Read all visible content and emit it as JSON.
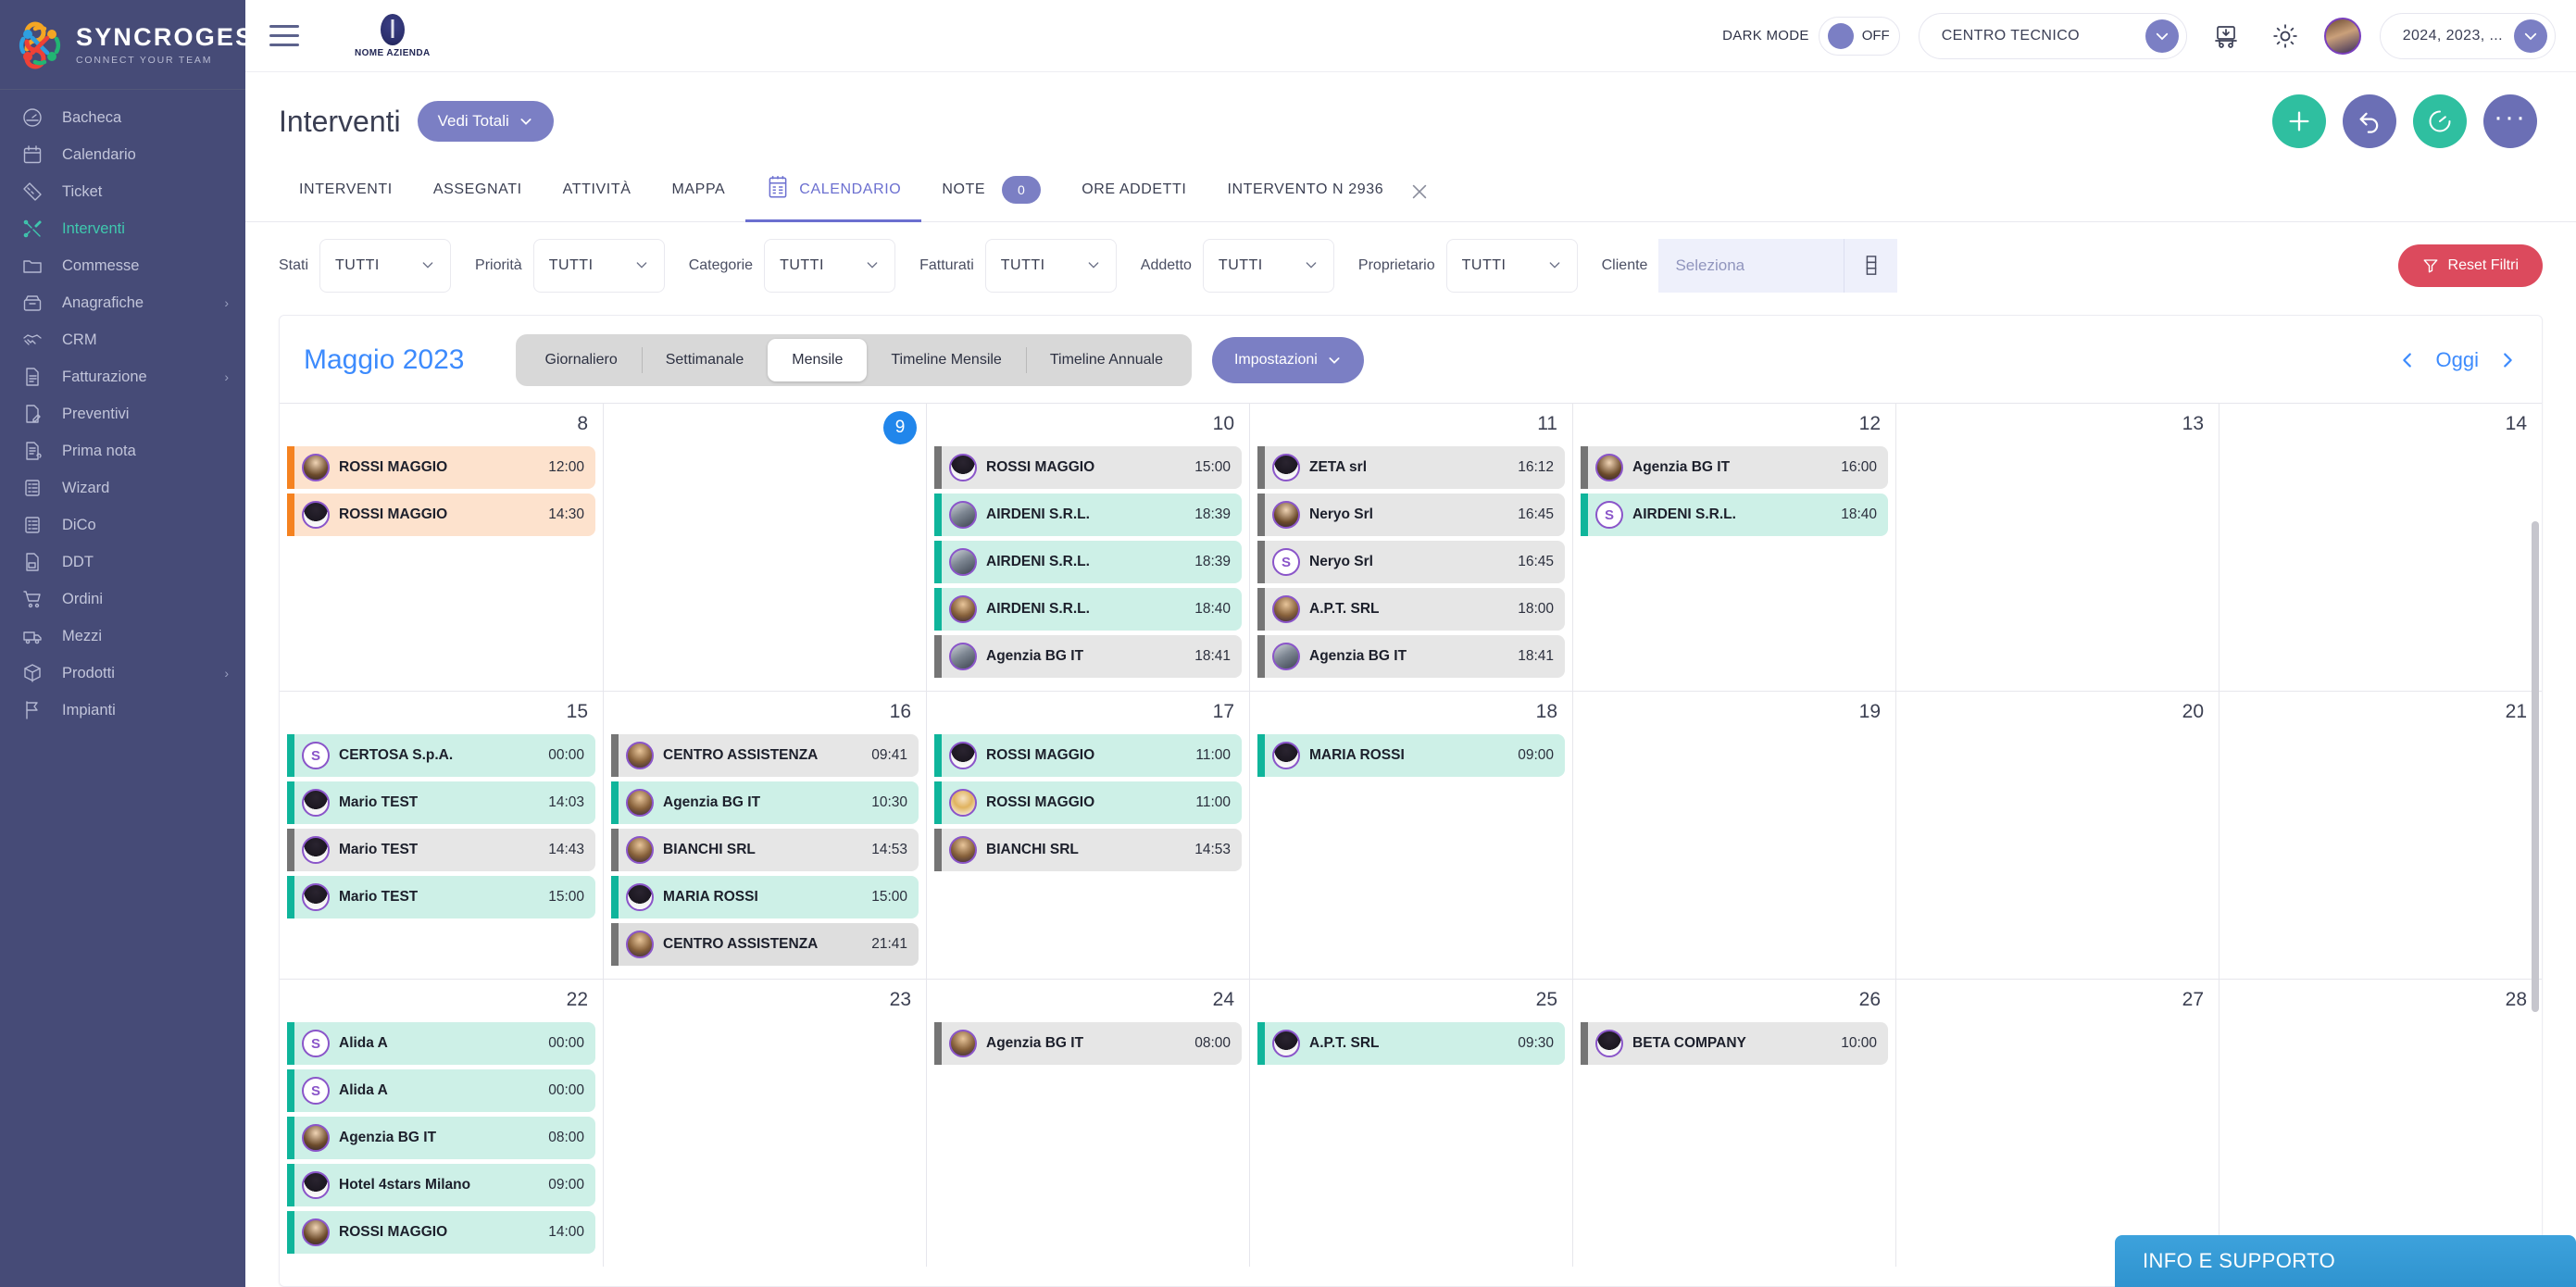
{
  "brand": {
    "name": "SYNCROGEST",
    "tagline": "CONNECT YOUR TEAM"
  },
  "sidebar": {
    "items": [
      {
        "label": "Bacheca",
        "icon": "gauge-icon",
        "active": false,
        "expandable": false
      },
      {
        "label": "Calendario",
        "icon": "calendar-icon",
        "active": false,
        "expandable": false
      },
      {
        "label": "Ticket",
        "icon": "ticket-icon",
        "active": false,
        "expandable": false
      },
      {
        "label": "Interventi",
        "icon": "tools-icon",
        "active": true,
        "expandable": false
      },
      {
        "label": "Commesse",
        "icon": "folder-icon",
        "active": false,
        "expandable": false
      },
      {
        "label": "Anagrafiche",
        "icon": "archive-icon",
        "active": false,
        "expandable": true
      },
      {
        "label": "CRM",
        "icon": "handshake-icon",
        "active": false,
        "expandable": false
      },
      {
        "label": "Fatturazione",
        "icon": "invoice-icon",
        "active": false,
        "expandable": true
      },
      {
        "label": "Preventivi",
        "icon": "quote-icon",
        "active": false,
        "expandable": false
      },
      {
        "label": "Prima nota",
        "icon": "note-attach-icon",
        "active": false,
        "expandable": false
      },
      {
        "label": "Wizard",
        "icon": "wizard-icon",
        "active": false,
        "expandable": false
      },
      {
        "label": "DiCo",
        "icon": "dico-icon",
        "active": false,
        "expandable": false
      },
      {
        "label": "DDT",
        "icon": "ddt-icon",
        "active": false,
        "expandable": false
      },
      {
        "label": "Ordini",
        "icon": "cart-icon",
        "active": false,
        "expandable": false
      },
      {
        "label": "Mezzi",
        "icon": "van-icon",
        "active": false,
        "expandable": false
      },
      {
        "label": "Prodotti",
        "icon": "box-icon",
        "active": false,
        "expandable": true
      },
      {
        "label": "Impianti",
        "icon": "flag-icon",
        "active": false,
        "expandable": false
      }
    ]
  },
  "topbar": {
    "company_name": "NOME AZIENDA",
    "dark_mode_label": "DARK MODE",
    "dark_mode_state": "OFF",
    "center_select": "CENTRO TECNICO",
    "years_select": "2024, 2023, ...",
    "icons": [
      "hamburger-icon",
      "warehouse-icon",
      "gear-icon",
      "avatar"
    ]
  },
  "page": {
    "title": "Interventi",
    "totals_button": "Vedi Totali",
    "actions": [
      "add-button",
      "undo-button",
      "timer-button",
      "more-button"
    ]
  },
  "tabs": [
    {
      "label": "INTERVENTI",
      "active": false,
      "icon": null,
      "badge": null,
      "closable": false
    },
    {
      "label": "ASSEGNATI",
      "active": false,
      "icon": null,
      "badge": null,
      "closable": false
    },
    {
      "label": "ATTIVITÀ",
      "active": false,
      "icon": null,
      "badge": null,
      "closable": false
    },
    {
      "label": "MAPPA",
      "active": false,
      "icon": null,
      "badge": null,
      "closable": false
    },
    {
      "label": "CALENDARIO",
      "active": true,
      "icon": "calendar-icon",
      "badge": null,
      "closable": false
    },
    {
      "label": "NOTE",
      "active": false,
      "icon": null,
      "badge": "0",
      "closable": false
    },
    {
      "label": "ORE ADDETTI",
      "active": false,
      "icon": null,
      "badge": null,
      "closable": false
    },
    {
      "label": "INTERVENTO N 2936",
      "active": false,
      "icon": null,
      "badge": null,
      "closable": true
    }
  ],
  "filters": {
    "items": [
      {
        "label": "Stati",
        "value": "TUTTI"
      },
      {
        "label": "Priorità",
        "value": "TUTTI"
      },
      {
        "label": "Categorie",
        "value": "TUTTI"
      },
      {
        "label": "Fatturati",
        "value": "TUTTI"
      },
      {
        "label": "Addetto",
        "value": "TUTTI"
      },
      {
        "label": "Proprietario",
        "value": "TUTTI"
      }
    ],
    "client_label": "Cliente",
    "client_placeholder": "Seleziona",
    "client_value": "",
    "reset_label": "Reset Filtri",
    "reset_color": "#dc4a5d"
  },
  "calendar": {
    "month_label": "Maggio 2023",
    "month_color": "#3d8bfd",
    "views": [
      {
        "label": "Giornaliero",
        "active": false
      },
      {
        "label": "Settimanale",
        "active": false
      },
      {
        "label": "Mensile",
        "active": true
      },
      {
        "label": "Timeline Mensile",
        "active": false
      },
      {
        "label": "Timeline Annuale",
        "active": false
      }
    ],
    "settings_button": "Impostazioni",
    "today_button": "Oggi",
    "today_day": 9,
    "weeks": [
      [
        {
          "day": "8",
          "today": false,
          "events": [
            {
              "name": "ROSSI MAGGIO",
              "time": "12:00",
              "bg": "bg-peach",
              "bar": "bar-orange",
              "avatar": "av-p1"
            },
            {
              "name": "ROSSI MAGGIO",
              "time": "14:30",
              "bg": "bg-peach",
              "bar": "bar-orange",
              "avatar": "av-p2"
            }
          ]
        },
        {
          "day": "9",
          "today": true,
          "events": []
        },
        {
          "day": "10",
          "today": false,
          "events": [
            {
              "name": "ROSSI MAGGIO",
              "time": "15:00",
              "bg": "bg-gray",
              "bar": "bar-gray",
              "avatar": "av-p2"
            },
            {
              "name": "AIRDENI S.R.L.",
              "time": "18:39",
              "bg": "bg-mint",
              "bar": "bar-teal",
              "avatar": "av-p3"
            },
            {
              "name": "AIRDENI S.R.L.",
              "time": "18:39",
              "bg": "bg-mint",
              "bar": "bar-teal",
              "avatar": "av-p3"
            },
            {
              "name": "AIRDENI S.R.L.",
              "time": "18:40",
              "bg": "bg-mint",
              "bar": "bar-teal",
              "avatar": "av-p4"
            },
            {
              "name": "Agenzia BG IT",
              "time": "18:41",
              "bg": "bg-gray",
              "bar": "bar-gray",
              "avatar": "av-p3"
            }
          ]
        },
        {
          "day": "11",
          "today": false,
          "events": [
            {
              "name": "ZETA srl",
              "time": "16:12",
              "bg": "bg-gray",
              "bar": "bar-gray",
              "avatar": "av-p2"
            },
            {
              "name": "Neryo Srl",
              "time": "16:45",
              "bg": "bg-gray",
              "bar": "bar-gray",
              "avatar": "av-p1"
            },
            {
              "name": "Neryo Srl",
              "time": "16:45",
              "bg": "bg-gray",
              "bar": "bar-gray",
              "avatar": "S"
            },
            {
              "name": "A.P.T. SRL",
              "time": "18:00",
              "bg": "bg-gray",
              "bar": "bar-gray",
              "avatar": "av-p4"
            },
            {
              "name": "Agenzia BG IT",
              "time": "18:41",
              "bg": "bg-gray",
              "bar": "bar-gray",
              "avatar": "av-p3"
            }
          ]
        },
        {
          "day": "12",
          "today": false,
          "events": [
            {
              "name": "Agenzia BG IT",
              "time": "16:00",
              "bg": "bg-gray",
              "bar": "bar-gray",
              "avatar": "av-p1"
            },
            {
              "name": "AIRDENI S.R.L.",
              "time": "18:40",
              "bg": "bg-mint",
              "bar": "bar-teal",
              "avatar": "S"
            }
          ]
        },
        {
          "day": "13",
          "today": false,
          "events": []
        },
        {
          "day": "14",
          "today": false,
          "events": []
        }
      ],
      [
        {
          "day": "15",
          "today": false,
          "events": [
            {
              "name": "CERTOSA S.p.A.",
              "time": "00:00",
              "bg": "bg-mint",
              "bar": "bar-teal",
              "avatar": "S"
            },
            {
              "name": "Mario TEST",
              "time": "14:03",
              "bg": "bg-mint",
              "bar": "bar-teal",
              "avatar": "av-p2"
            },
            {
              "name": "Mario TEST",
              "time": "14:43",
              "bg": "bg-gray",
              "bar": "bar-gray",
              "avatar": "av-p2"
            },
            {
              "name": "Mario TEST",
              "time": "15:00",
              "bg": "bg-mint",
              "bar": "bar-teal",
              "avatar": "av-p2"
            }
          ]
        },
        {
          "day": "16",
          "today": false,
          "events": [
            {
              "name": "CENTRO ASSISTENZA",
              "time": "09:41",
              "bg": "bg-gray",
              "bar": "bar-gray",
              "avatar": "av-p4"
            },
            {
              "name": "Agenzia BG IT",
              "time": "10:30",
              "bg": "bg-mint",
              "bar": "bar-teal",
              "avatar": "av-p4"
            },
            {
              "name": "BIANCHI SRL",
              "time": "14:53",
              "bg": "bg-gray",
              "bar": "bar-gray",
              "avatar": "av-p4"
            },
            {
              "name": "MARIA ROSSI",
              "time": "15:00",
              "bg": "bg-mint",
              "bar": "bar-teal",
              "avatar": "av-p2"
            },
            {
              "name": "CENTRO ASSISTENZA",
              "time": "21:41",
              "bg": "bg-gray2",
              "bar": "bar-gray",
              "avatar": "av-p4"
            }
          ]
        },
        {
          "day": "17",
          "today": false,
          "events": [
            {
              "name": "ROSSI MAGGIO",
              "time": "11:00",
              "bg": "bg-mint",
              "bar": "bar-teal",
              "avatar": "av-p2"
            },
            {
              "name": "ROSSI MAGGIO",
              "time": "11:00",
              "bg": "bg-mint",
              "bar": "bar-teal",
              "avatar": "av-p5"
            },
            {
              "name": "BIANCHI SRL",
              "time": "14:53",
              "bg": "bg-gray",
              "bar": "bar-gray",
              "avatar": "av-p4"
            }
          ]
        },
        {
          "day": "18",
          "today": false,
          "events": [
            {
              "name": "MARIA ROSSI",
              "time": "09:00",
              "bg": "bg-mint",
              "bar": "bar-teal",
              "avatar": "av-p2"
            }
          ]
        },
        {
          "day": "19",
          "today": false,
          "events": []
        },
        {
          "day": "20",
          "today": false,
          "events": []
        },
        {
          "day": "21",
          "today": false,
          "events": []
        }
      ],
      [
        {
          "day": "22",
          "today": false,
          "events": [
            {
              "name": "Alida A",
              "time": "00:00",
              "bg": "bg-mint",
              "bar": "bar-teal",
              "avatar": "S"
            },
            {
              "name": "Alida A",
              "time": "00:00",
              "bg": "bg-mint",
              "bar": "bar-teal",
              "avatar": "S"
            },
            {
              "name": "Agenzia BG IT",
              "time": "08:00",
              "bg": "bg-mint",
              "bar": "bar-teal",
              "avatar": "av-p1"
            },
            {
              "name": "Hotel 4stars Milano",
              "time": "09:00",
              "bg": "bg-mint",
              "bar": "bar-teal",
              "avatar": "av-p2"
            },
            {
              "name": "ROSSI MAGGIO",
              "time": "14:00",
              "bg": "bg-mint",
              "bar": "bar-teal",
              "avatar": "av-p1"
            }
          ]
        },
        {
          "day": "23",
          "today": false,
          "events": []
        },
        {
          "day": "24",
          "today": false,
          "events": [
            {
              "name": "Agenzia BG IT",
              "time": "08:00",
              "bg": "bg-gray",
              "bar": "bar-gray",
              "avatar": "av-p4"
            }
          ]
        },
        {
          "day": "25",
          "today": false,
          "events": [
            {
              "name": "A.P.T. SRL",
              "time": "09:30",
              "bg": "bg-mint",
              "bar": "bar-teal",
              "avatar": "av-p2"
            }
          ]
        },
        {
          "day": "26",
          "today": false,
          "events": [
            {
              "name": "BETA COMPANY",
              "time": "10:00",
              "bg": "bg-gray",
              "bar": "bar-gray",
              "avatar": "av-p2"
            }
          ]
        },
        {
          "day": "27",
          "today": false,
          "events": []
        },
        {
          "day": "28",
          "today": false,
          "events": []
        }
      ]
    ]
  },
  "support": {
    "label": "INFO E SUPPORTO",
    "color": "#3da2dc"
  }
}
